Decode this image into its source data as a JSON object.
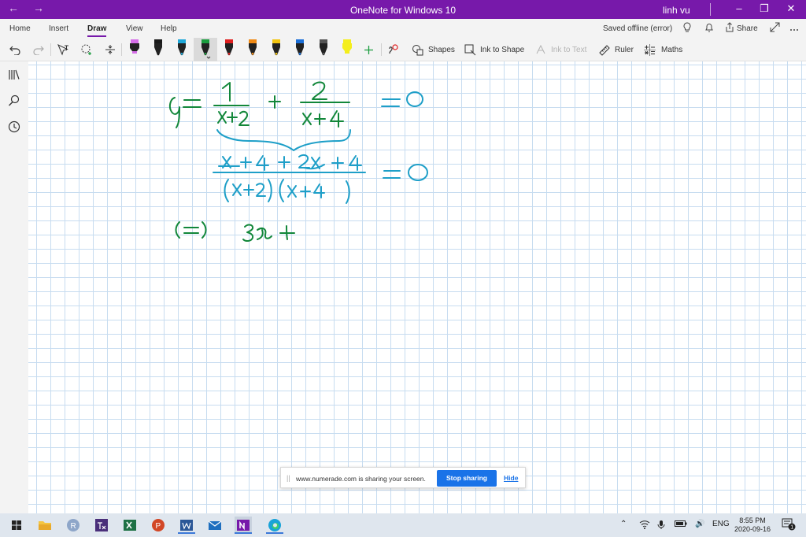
{
  "window": {
    "title": "OneNote for Windows 10",
    "user": "linh vu"
  },
  "menu": {
    "tabs": [
      "Home",
      "Insert",
      "Draw",
      "View",
      "Help"
    ],
    "active_tab": "Draw",
    "status": "Saved offline (error)",
    "share_label": "Share"
  },
  "toolbar": {
    "shapes_label": "Shapes",
    "ink_to_shape_label": "Ink to Shape",
    "ink_to_text_label": "Ink to Text",
    "ruler_label": "Ruler",
    "maths_label": "Maths",
    "accent": "#7719aa",
    "pens": [
      {
        "name": "purple-highlighter",
        "color": "#d56ee8"
      },
      {
        "name": "black-pen",
        "color": "#1a1a1a"
      },
      {
        "name": "cyan-pen",
        "color": "#1ea7d8"
      },
      {
        "name": "green-pen",
        "color": "#1a9c3e",
        "selected": true
      },
      {
        "name": "red-pen",
        "color": "#e02020"
      },
      {
        "name": "orange-pen",
        "color": "#f08a15"
      },
      {
        "name": "yellow-pen",
        "color": "#f2c40f"
      },
      {
        "name": "blue-pen",
        "color": "#1b6fd8"
      },
      {
        "name": "galaxy-pen",
        "color": "#555555"
      },
      {
        "name": "yellow-highlighter",
        "color": "#f4ee1c"
      }
    ]
  },
  "canvas": {
    "ink_green": "#12873a",
    "ink_teal": "#1e9fc8",
    "grid_color": "#c7dcf0"
  },
  "sharing": {
    "message": "www.numerade.com is sharing your screen.",
    "stop_label": "Stop sharing",
    "hide_label": "Hide"
  },
  "taskbar": {
    "language": "ENG",
    "time": "8:55 PM",
    "date": "2020-09-16",
    "notification_count": "1"
  }
}
